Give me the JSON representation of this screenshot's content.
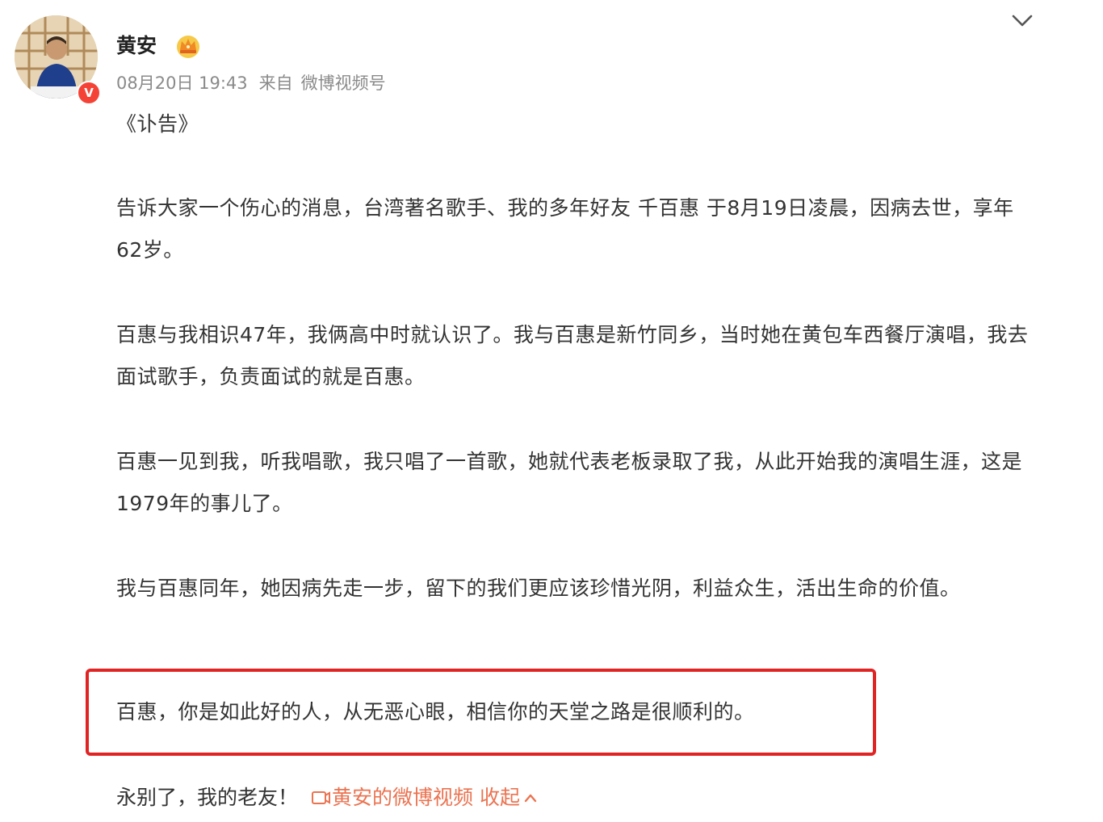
{
  "post": {
    "author": {
      "name": "黄安",
      "verified_mark": "V",
      "badge_icon": "crown-icon"
    },
    "meta": {
      "time": "08月20日 19:43",
      "source_prefix": "来自",
      "source": "微博视频号"
    },
    "title": "《讣告》",
    "paragraphs": [
      "告诉大家一个伤心的消息，台湾著名歌手、我的多年好友 千百惠 于8月19日凌晨，因病去世，享年62岁。",
      "百惠与我相识47年，我俩高中时就认识了。我与百惠是新竹同乡，当时她在黄包车西餐厅演唱，我去面试歌手，负责面试的就是百惠。",
      "百惠一见到我，听我唱歌，我只唱了一首歌，她就代表老板录取了我，从此开始我的演唱生涯，这是1979年的事儿了。",
      "我与百惠同年，她因病先走一步，留下的我们更应该珍惜光阴，利益众生，活出生命的价值。"
    ],
    "highlighted": "百惠，你是如此好的人，从无恶心眼，相信你的天堂之路是很顺利的。",
    "closing": "永别了，我的老友！",
    "video_link": "黄安的微博视频",
    "collapse": "收起",
    "colors": {
      "highlight_border": "#e02424",
      "link": "#eb7350",
      "meta": "#8a8a8a",
      "verified": "#f44336"
    }
  }
}
